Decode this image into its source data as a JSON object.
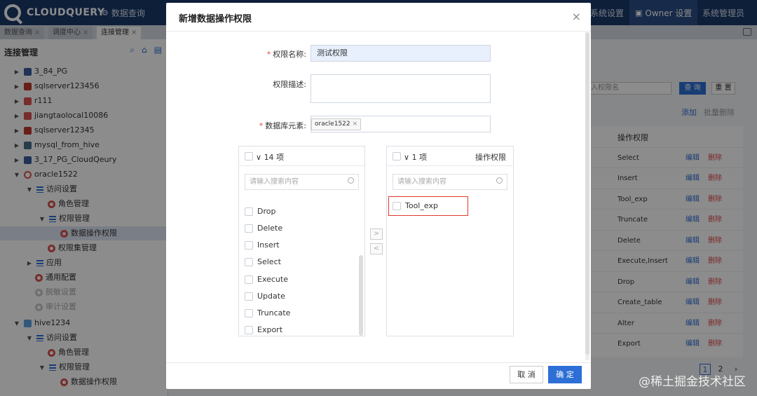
{
  "brand": "CLOUDQUERY",
  "colors": {
    "topbar": "#1b3a6b",
    "accent": "#2d6fd6",
    "danger": "#e24a4a",
    "highlight": "#e0392b"
  },
  "topnav": {
    "query": "数据查询",
    "system_settings": "系统设置",
    "owner_settings": "Owner 设置",
    "admin": "系统管理员"
  },
  "tabs": [
    "数据查询",
    "调度中心",
    "连接管理"
  ],
  "sidebar": {
    "title": "连接管理",
    "tree": [
      {
        "label": "3_84_PG",
        "icon": "postgres-icon"
      },
      {
        "label": "sqlserver123456",
        "icon": "sqlserver-icon"
      },
      {
        "label": "r111",
        "icon": "db-icon"
      },
      {
        "label": "jiangtaolocal10086",
        "icon": "db-icon"
      },
      {
        "label": "sqlserver12345",
        "icon": "sqlserver-icon"
      },
      {
        "label": "mysql_from_hive",
        "icon": "mysql-icon"
      },
      {
        "label": "3_17_PG_CloudQeury",
        "icon": "postgres-icon"
      },
      {
        "label": "oracle1522",
        "icon": "oracle-icon"
      },
      {
        "label": "访问设置"
      },
      {
        "label": "角色管理"
      },
      {
        "label": "权限管理"
      },
      {
        "label": "数据操作权限"
      },
      {
        "label": "权限集管理"
      },
      {
        "label": "应用"
      },
      {
        "label": "通用配置"
      },
      {
        "label": "脱敏设置"
      },
      {
        "label": "审计设置"
      },
      {
        "label": "hive1234",
        "icon": "hive-icon"
      },
      {
        "label": "访问设置"
      },
      {
        "label": "角色管理"
      },
      {
        "label": "权限管理"
      },
      {
        "label": "数据操作权限"
      }
    ]
  },
  "background_panel": {
    "search_placeholder": "入权限名",
    "query_label": "查 询",
    "reset_label": "重 置",
    "add_label": "添加",
    "batch_delete_label": "批量删除",
    "column_header": "操作权限",
    "edit_label": "编辑",
    "delete_label": "删除",
    "rows": [
      "Select",
      "Insert",
      "Tool_exp",
      "Truncate",
      "Delete",
      "Execute,Insert",
      "Drop",
      "Create_table",
      "Alter",
      "Export"
    ],
    "pager": [
      "1",
      "2"
    ]
  },
  "modal": {
    "title": "新增数据操作权限",
    "name_label": "权限名称:",
    "name_value": "测试权限",
    "desc_label": "权限描述:",
    "db_label": "数据库元素:",
    "db_tag": "oracle1522",
    "left_list": {
      "count": "14 项",
      "search_placeholder": "请输入搜索内容",
      "items": [
        "Drop",
        "Delete",
        "Insert",
        "Select",
        "Execute",
        "Update",
        "Truncate",
        "Export"
      ]
    },
    "right_list": {
      "count": "1 项",
      "title": "操作权限",
      "search_placeholder": "请输入搜索内容",
      "items": [
        "Tool_exp"
      ]
    },
    "cancel_label": "取 消",
    "ok_label": "确 定"
  },
  "watermark": "@稀土掘金技术社区"
}
